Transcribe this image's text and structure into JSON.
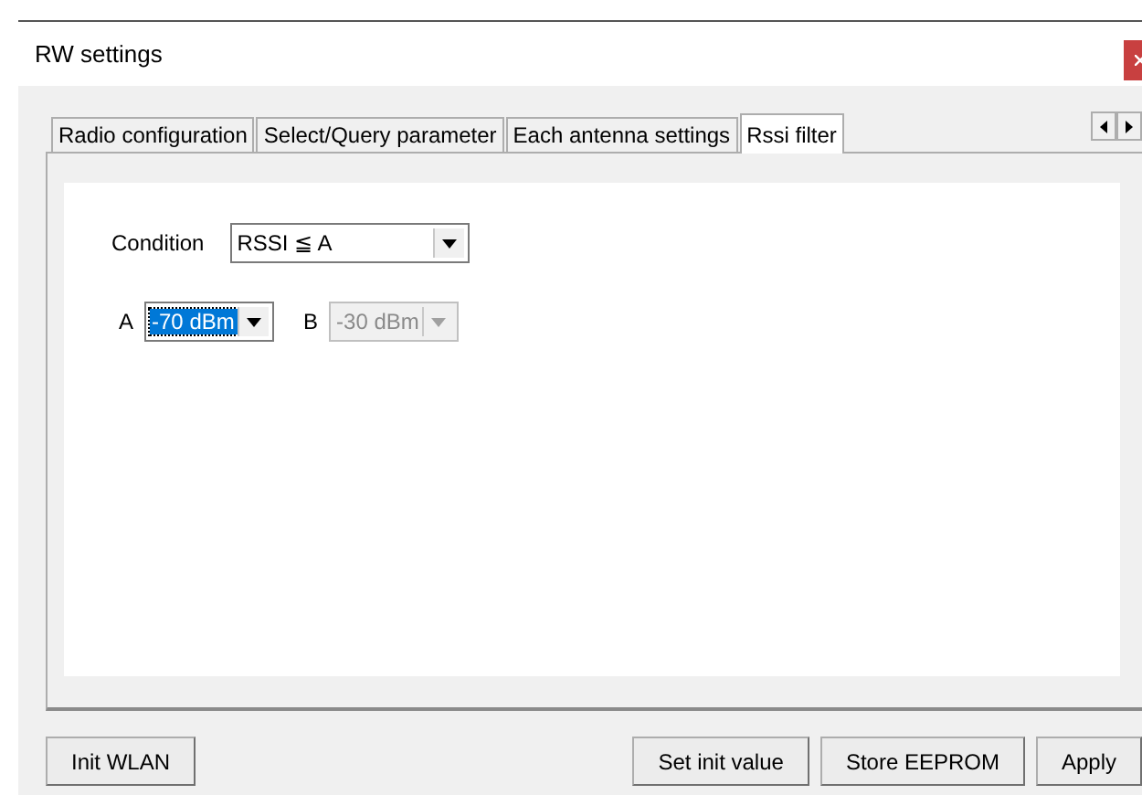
{
  "window": {
    "title": "RW settings"
  },
  "tabs": [
    {
      "label": "Radio configuration",
      "selected": false
    },
    {
      "label": "Select/Query parameter",
      "selected": false
    },
    {
      "label": "Each antenna settings",
      "selected": false
    },
    {
      "label": "Rssi filter",
      "selected": true
    }
  ],
  "condition": {
    "label": "Condition",
    "value": "RSSI ≦ A"
  },
  "fields": [
    {
      "label": "A",
      "value": "-70 dBm",
      "focused": true,
      "disabled": false
    },
    {
      "label": "B",
      "value": "-30 dBm",
      "focused": false,
      "disabled": true
    }
  ],
  "buttons": [
    {
      "label": "Init WLAN"
    },
    {
      "label": "Set init value"
    },
    {
      "label": "Store EEPROM"
    },
    {
      "label": "Apply"
    }
  ]
}
